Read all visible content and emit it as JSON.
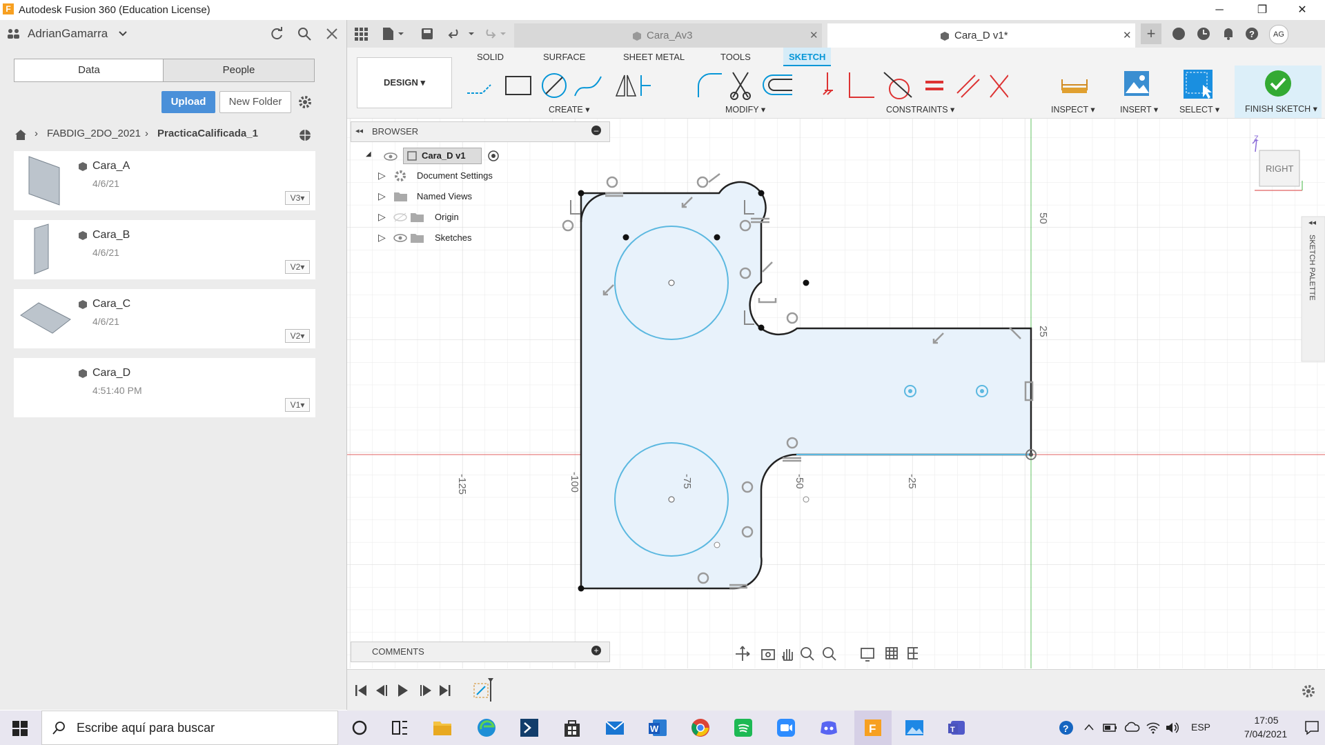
{
  "window": {
    "title": "Autodesk Fusion 360 (Education License)",
    "icon_letter": "F",
    "minimize": "─",
    "maximize": "❐",
    "close": "✕"
  },
  "data_panel": {
    "user": "AdrianGamarra",
    "tabs": [
      "Data",
      "People"
    ],
    "upload_label": "Upload",
    "new_folder_label": "New Folder",
    "breadcrumb": [
      "FABDIG_2DO_2021",
      "PracticaCalificada_1"
    ],
    "files": [
      {
        "name": "Cara_A",
        "date": "4/6/21",
        "version": "V3▾"
      },
      {
        "name": "Cara_B",
        "date": "4/6/21",
        "version": "V2▾"
      },
      {
        "name": "Cara_C",
        "date": "4/6/21",
        "version": "V2▾"
      },
      {
        "name": "Cara_D",
        "date": "4:51:40 PM",
        "version": "V1▾"
      }
    ]
  },
  "doc_tabs": [
    {
      "label": "Cara_Av3",
      "active": false
    },
    {
      "label": "Cara_D v1*",
      "active": true
    }
  ],
  "toolbar": {
    "workspace": "DESIGN ▾",
    "tabs": [
      "SOLID",
      "SURFACE",
      "SHEET METAL",
      "TOOLS",
      "SKETCH"
    ],
    "active_tab": "SKETCH",
    "groups": {
      "create": "CREATE ▾",
      "modify": "MODIFY ▾",
      "constraints": "CONSTRAINTS ▾",
      "inspect": "INSPECT ▾",
      "insert": "INSERT ▾",
      "select": "SELECT ▾",
      "finish": "FINISH SKETCH ▾"
    }
  },
  "browser": {
    "title": "BROWSER",
    "root": "Cara_D v1",
    "nodes": [
      "Document Settings",
      "Named Views",
      "Origin",
      "Sketches"
    ]
  },
  "comments": {
    "title": "COMMENTS"
  },
  "viewcube": {
    "face": "RIGHT",
    "axis_z": "Z"
  },
  "sketch_palette": {
    "label": "SKETCH PALETTE"
  },
  "axis_ticks": {
    "horizontal": [
      "-125",
      "-100",
      "-75",
      "-50",
      "-25"
    ],
    "vertical": [
      "50",
      "25"
    ]
  },
  "colors": {
    "accent": "#0696d7",
    "sketch_fill": "#e8f2fb",
    "sketch_line": "#222222",
    "circle_line": "#5bb8e0",
    "axis_x": "#e06060",
    "axis_y": "#60c060",
    "finish_green": "#33aa33"
  },
  "taskbar": {
    "search_placeholder": "Escribe aquí para buscar",
    "language": "ESP",
    "time": "17:05",
    "date": "7/04/2021"
  }
}
